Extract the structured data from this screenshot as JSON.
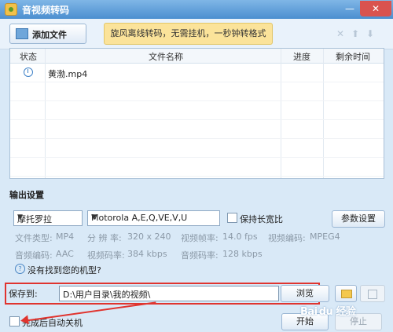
{
  "window": {
    "title": "音视频转码",
    "minimize_glyph": "—",
    "close_glyph": "✕"
  },
  "toolbar": {
    "add_file_label": "添加文件",
    "promo_text": "旋风离线转码，无需挂机，一秒钟转格式",
    "icons": [
      "delete-icon",
      "move-up-icon",
      "move-down-icon"
    ],
    "delete_glyph": "✕",
    "up_glyph": "⬆",
    "down_glyph": "⬇"
  },
  "file_table": {
    "columns": [
      "状态",
      "文件名称",
      "进度",
      "剩余时间"
    ],
    "rows": [
      {
        "status_icon": "clock-icon",
        "name": "黄渤.mp4",
        "progress": "",
        "remaining": ""
      }
    ]
  },
  "output_settings": {
    "header": "输出设置",
    "brand_select": "摩托罗拉",
    "model_select": "Motorola A,E,Q,VE,V,U",
    "keep_aspect_label": "保持长宽比",
    "param_button": "参数设置",
    "file_type_label": "文件类型:",
    "file_type_value": "MP4",
    "resolution_label": "分 辨 率:",
    "resolution_value": "320 x 240",
    "video_framerate_label": "视频帧率:",
    "video_framerate_value": "14.0 fps",
    "video_codec_label": "视频编码:",
    "video_codec_value": "MPEG4",
    "audio_codec_label": "音频编码:",
    "audio_codec_value": "AAC",
    "video_bitrate_label": "视频码率:",
    "video_bitrate_value": "384 kbps",
    "audio_bitrate_label": "音频码率:",
    "audio_bitrate_value": "128 kbps",
    "missing_model_link": "没有找到您的机型?"
  },
  "save": {
    "label": "保存到:",
    "path": "D:\\用户目录\\我的视频\\",
    "browse_button": "浏览"
  },
  "footer": {
    "shutdown_label": "完成后自动关机",
    "start_button": "开始",
    "stop_button": "停止"
  },
  "watermark": "Bai du 经验"
}
